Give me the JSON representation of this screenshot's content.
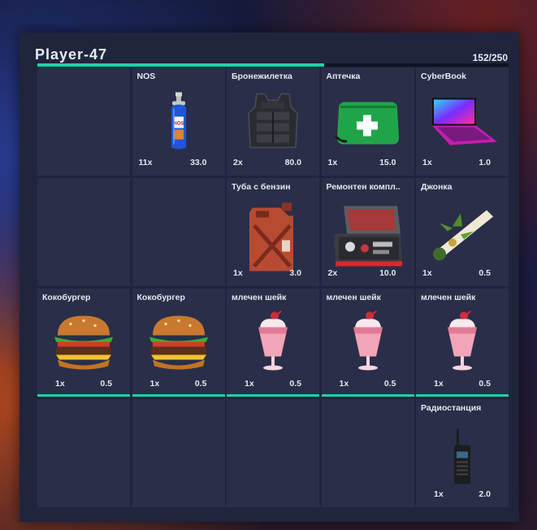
{
  "inventory": {
    "player_name": "Player-47",
    "weight": "152/250",
    "capacity_fraction": 0.608,
    "accent_color": "#1fd1a8"
  },
  "slots": [
    {
      "name": "",
      "qty": "",
      "weight": "",
      "icon": ""
    },
    {
      "name": "NOS",
      "qty": "11x",
      "weight": "33.0",
      "icon": "nos-bottle-icon"
    },
    {
      "name": "Бронежилетка",
      "qty": "2x",
      "weight": "80.0",
      "icon": "body-armor-icon"
    },
    {
      "name": "Аптечка",
      "qty": "1x",
      "weight": "15.0",
      "icon": "first-aid-kit-icon"
    },
    {
      "name": "CyberBook",
      "qty": "1x",
      "weight": "1.0",
      "icon": "laptop-icon"
    },
    {
      "name": "",
      "qty": "",
      "weight": "",
      "icon": ""
    },
    {
      "name": "",
      "qty": "",
      "weight": "",
      "icon": ""
    },
    {
      "name": "Туба с бензин",
      "qty": "1x",
      "weight": "3.0",
      "icon": "jerrycan-icon"
    },
    {
      "name": "Ремонтен компл..",
      "qty": "2x",
      "weight": "10.0",
      "icon": "repair-kit-icon"
    },
    {
      "name": "Джонка",
      "qty": "1x",
      "weight": "0.5",
      "icon": "joint-icon"
    },
    {
      "name": "Кокобургер",
      "qty": "1x",
      "weight": "0.5",
      "icon": "burger-icon"
    },
    {
      "name": "Кокобургер",
      "qty": "1x",
      "weight": "0.5",
      "icon": "burger-icon"
    },
    {
      "name": "млечен шейк",
      "qty": "1x",
      "weight": "0.5",
      "icon": "milkshake-icon"
    },
    {
      "name": "млечен шейк",
      "qty": "1x",
      "weight": "0.5",
      "icon": "milkshake-icon"
    },
    {
      "name": "млечен шейк",
      "qty": "1x",
      "weight": "0.5",
      "icon": "milkshake-icon"
    },
    {
      "name": "",
      "qty": "",
      "weight": "",
      "icon": ""
    },
    {
      "name": "",
      "qty": "",
      "weight": "",
      "icon": ""
    },
    {
      "name": "",
      "qty": "",
      "weight": "",
      "icon": ""
    },
    {
      "name": "",
      "qty": "",
      "weight": "",
      "icon": ""
    },
    {
      "name": "Радиостанция",
      "qty": "1x",
      "weight": "2.0",
      "icon": "radio-icon"
    }
  ]
}
